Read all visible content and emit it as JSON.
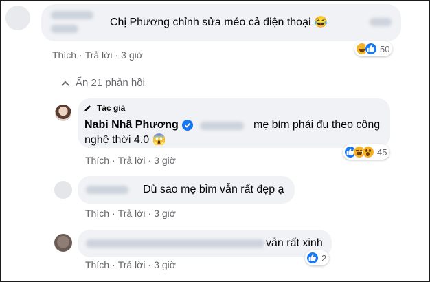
{
  "comment1": {
    "text": "Chị Phương chỉnh sửa méo cả điện thoại 😂",
    "actions": {
      "like": "Thích",
      "reply": "Trả lời",
      "time": "3 giờ"
    },
    "reaction_count": "50",
    "reaction_icons": [
      "haha-icon",
      "like-icon"
    ]
  },
  "replies_toggle": {
    "label": "Ẩn 21 phản hồi",
    "icon": "chevron-up-icon"
  },
  "reply1": {
    "author_badge": "Tác giả",
    "author": "Nabi Nhã Phương",
    "text_line1": "mẹ bỉm phải đu theo công",
    "text_line2": "nghệ thời 4.0 😱",
    "actions": {
      "like": "Thích",
      "reply": "Trả lời",
      "time": "3 giờ"
    },
    "reaction_count": "45",
    "reaction_icons": [
      "like-icon",
      "haha-icon",
      "wow-icon"
    ]
  },
  "reply2": {
    "text": "Dù sao mẹ bỉm vẫn rất đẹp ạ",
    "actions": {
      "like": "Thích",
      "reply": "Trả lời",
      "time": "3 giờ"
    }
  },
  "reply3": {
    "text": "vẫn rất xinh",
    "actions": {
      "like": "Thích",
      "reply": "Trả lời",
      "time": "3 giờ"
    },
    "reaction_count": "2",
    "reaction_icons": [
      "like-icon"
    ]
  },
  "colors": {
    "bubble": "#f0f2f5",
    "meta": "#65676b",
    "link": "#385898",
    "verified": "#1877f2"
  }
}
